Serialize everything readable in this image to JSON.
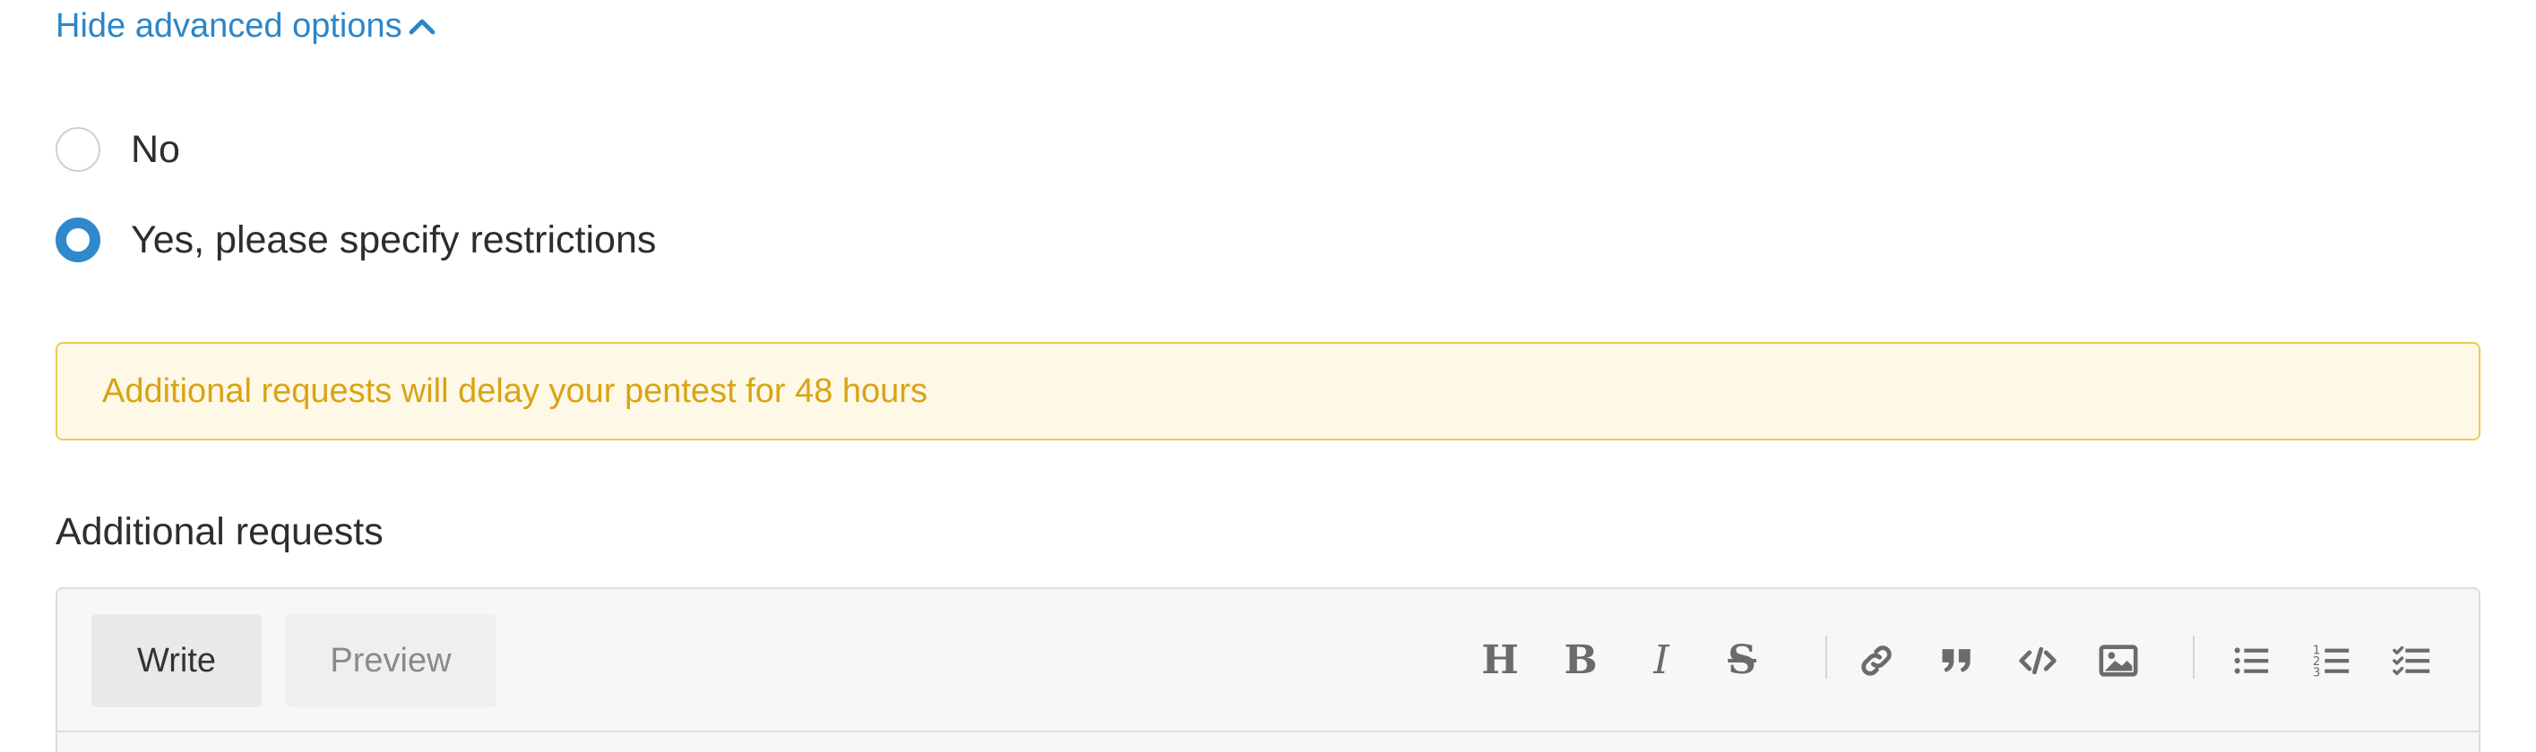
{
  "advanced_toggle": {
    "label": "Hide advanced options",
    "icon": "chevron-up-icon",
    "color": "#2b86c8"
  },
  "restrictions": {
    "options": [
      {
        "label": "No",
        "checked": false
      },
      {
        "label": "Yes, please specify restrictions",
        "checked": true
      }
    ]
  },
  "warning": {
    "text": "Additional requests will delay your pentest for 48 hours",
    "text_color": "#d9a414",
    "background": "#fef8e7",
    "border": "#f2c94c"
  },
  "additional_requests": {
    "label": "Additional requests",
    "editor": {
      "tabs": [
        {
          "label": "Write",
          "active": true
        },
        {
          "label": "Preview",
          "active": false
        }
      ],
      "toolbar": {
        "groups": [
          [
            "heading-icon",
            "bold-icon",
            "italic-icon",
            "strikethrough-icon"
          ],
          [
            "link-icon",
            "quote-icon",
            "code-icon",
            "image-icon"
          ],
          [
            "bulleted-list-icon",
            "numbered-list-icon",
            "task-list-icon"
          ]
        ]
      }
    }
  }
}
